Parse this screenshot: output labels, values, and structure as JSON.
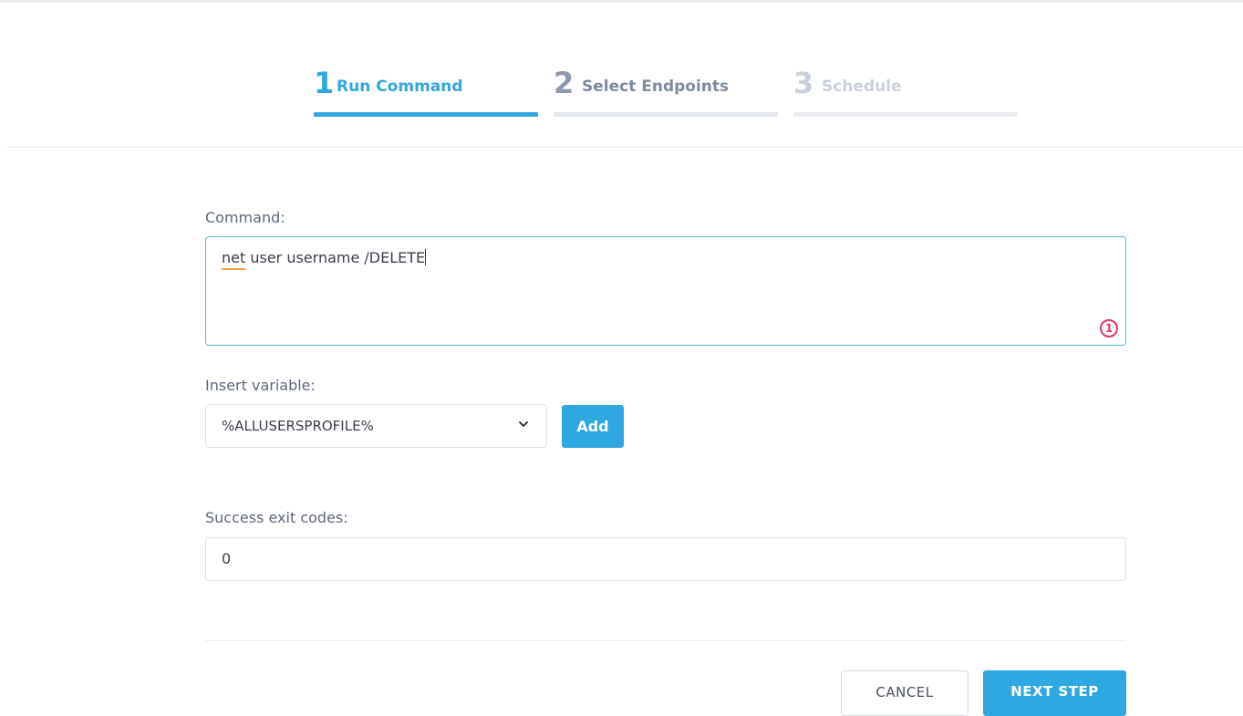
{
  "stepper": {
    "steps": [
      {
        "number": "1",
        "label": "Run Command",
        "state": "active"
      },
      {
        "number": "2",
        "label": "Select Endpoints",
        "state": "next"
      },
      {
        "number": "3",
        "label": "Schedule",
        "state": "future"
      }
    ]
  },
  "form": {
    "command": {
      "label": "Command:",
      "value_first_word": "net",
      "value_rest": " user username /DELETE",
      "issue_count": "1"
    },
    "insert_variable": {
      "label": "Insert variable:",
      "selected": "%ALLUSERSPROFILE%",
      "add_label": "Add"
    },
    "exit_codes": {
      "label": "Success exit codes:",
      "value": "0"
    }
  },
  "footer": {
    "cancel_label": "CANCEL",
    "next_label": "NEXT STEP"
  },
  "colors": {
    "accent": "#2fa7e0",
    "error": "#e8345f",
    "spell_underline": "#f0a23c"
  },
  "icons": {
    "select_chevron": "chevron-down-icon",
    "issue_badge": "error-count-icon"
  }
}
